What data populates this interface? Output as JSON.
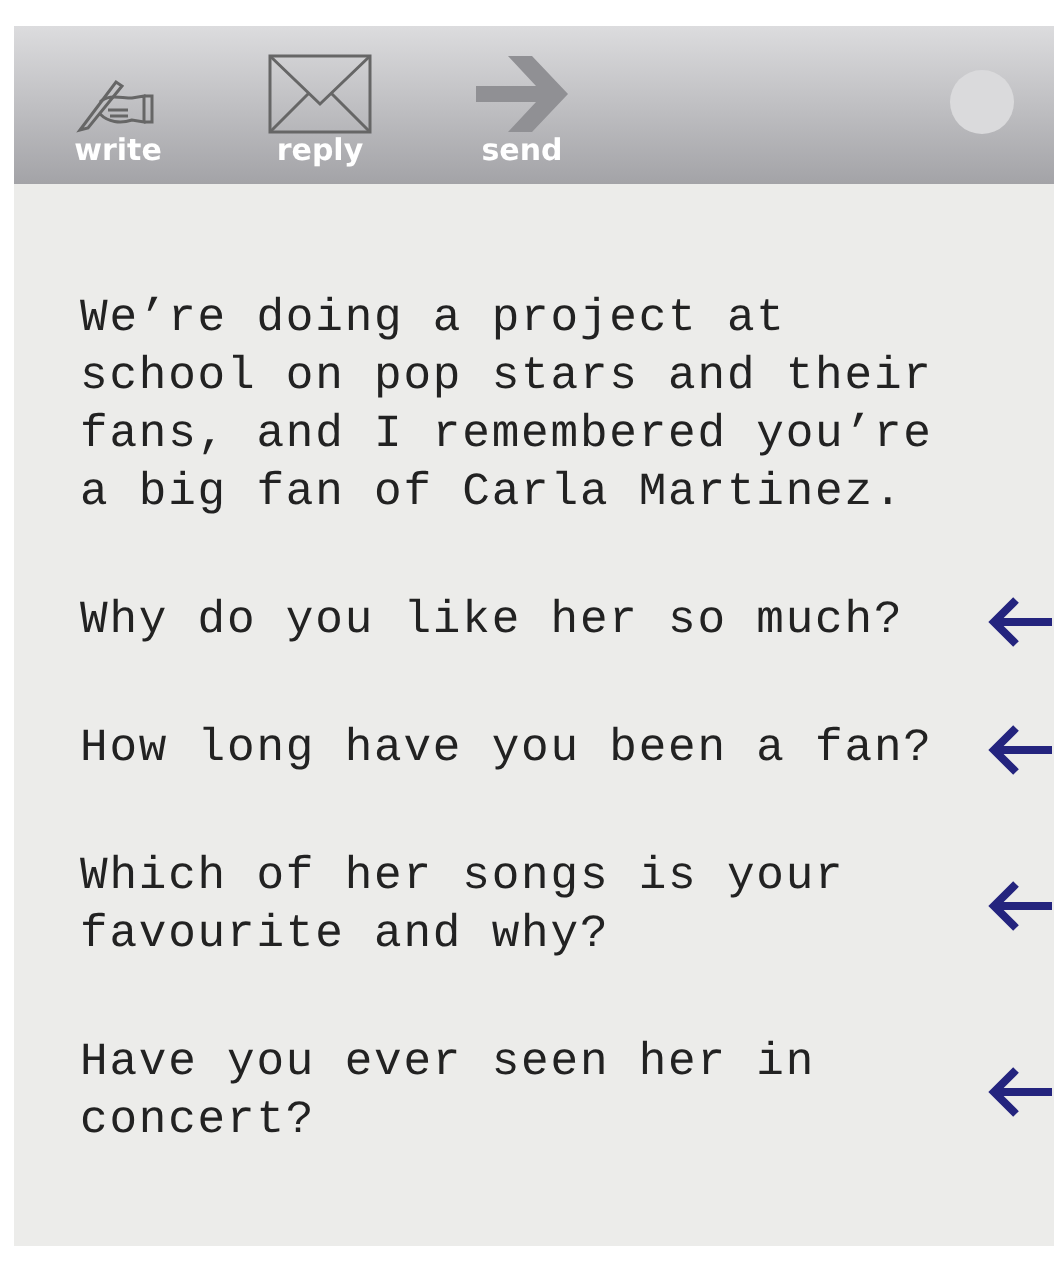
{
  "toolbar": {
    "buttons": [
      {
        "kind": "write",
        "label": "write"
      },
      {
        "kind": "reply",
        "label": "reply"
      },
      {
        "kind": "send",
        "label": "send"
      }
    ]
  },
  "message": {
    "intro": "We’re doing a project at school on pop stars and their fans, and I remembered you’re a big fan of Carla Martinez.",
    "questions": [
      {
        "text": "Why do you like her so much?"
      },
      {
        "text": "How long have you been a fan?"
      },
      {
        "text": "Which of her songs is your favourite and why?"
      },
      {
        "text": "Have you ever seen her in concert?"
      }
    ]
  }
}
